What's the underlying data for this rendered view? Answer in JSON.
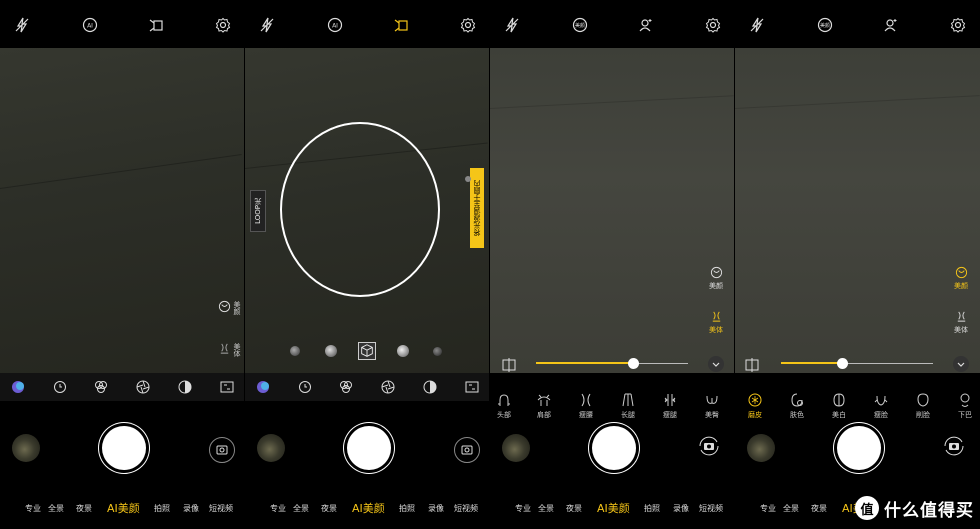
{
  "icons": {
    "flash": "flash-off-icon",
    "ai": "ai-icon",
    "portrait": "portrait-icon",
    "settings": "gear-icon",
    "color": "#f5c518"
  },
  "ai_badge": "AI",
  "beauty_badge": "美颜",
  "modes": [
    "专业",
    "全景",
    "夜景",
    "AI美颜",
    "拍照",
    "录像",
    "短视频"
  ],
  "panel1": {
    "side_beauty": "美颜",
    "side_body": "美体"
  },
  "panel2": {
    "light_label": "LOOP光",
    "hint": "将光源调至于圆内"
  },
  "panel3": {
    "side_beauty": "美颜",
    "side_body": "美体",
    "slider_value": 0.64,
    "tools": [
      "头部",
      "肩部",
      "瘦腰",
      "长腿",
      "瘦腿",
      "美臀"
    ]
  },
  "panel4": {
    "side_beauty": "美颜",
    "side_body": "美体",
    "slider_value": 0.4,
    "tools": [
      "磨皮",
      "肤色",
      "美白",
      "瘦脸",
      "削脸",
      "下巴"
    ]
  },
  "watermark": {
    "logo": "值",
    "text": "什么值得买"
  }
}
